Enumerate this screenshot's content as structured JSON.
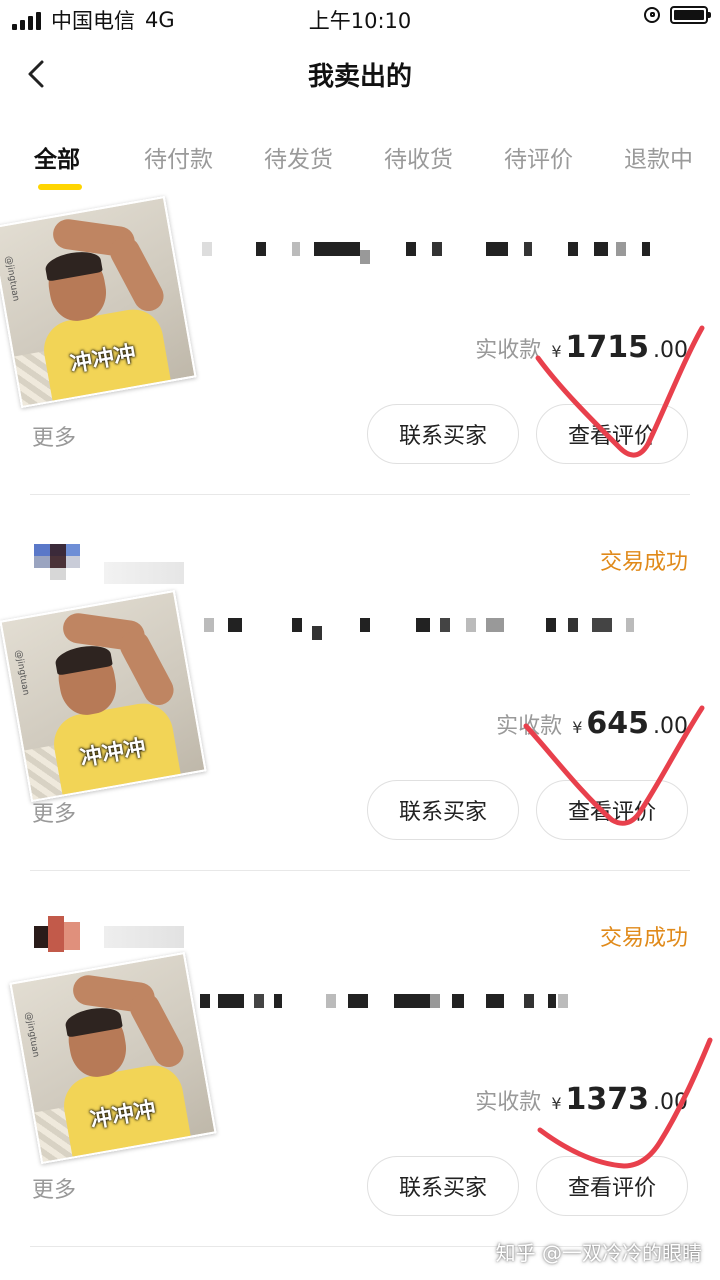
{
  "status_bar": {
    "carrier": "中国电信",
    "network": "4G",
    "time": "上午10:10"
  },
  "nav": {
    "title": "我卖出的"
  },
  "tabs": [
    {
      "label": "全部"
    },
    {
      "label": "待付款"
    },
    {
      "label": "待发货"
    },
    {
      "label": "待收货"
    },
    {
      "label": "待评价"
    },
    {
      "label": "退款中"
    }
  ],
  "orders": [
    {
      "status": "",
      "thumb_caption": "冲冲冲",
      "thumb_watermark": "@jingtuan",
      "price_label": "实收款",
      "price_currency": "¥",
      "price_int": "1715",
      "price_dec": ".00",
      "more_label": "更多",
      "contact_label": "联系买家",
      "review_label": "查看评价"
    },
    {
      "status": "交易成功",
      "thumb_caption": "冲冲冲",
      "thumb_watermark": "@jingtuan",
      "price_label": "实收款",
      "price_currency": "¥",
      "price_int": "645",
      "price_dec": ".00",
      "more_label": "更多",
      "contact_label": "联系买家",
      "review_label": "查看评价"
    },
    {
      "status": "交易成功",
      "thumb_caption": "冲冲冲",
      "thumb_watermark": "@jingtuan",
      "price_label": "实收款",
      "price_currency": "¥",
      "price_int": "1373",
      "price_dec": ".00",
      "more_label": "更多",
      "contact_label": "联系买家",
      "review_label": "查看评价"
    }
  ],
  "colors": {
    "accent": "#ffd500",
    "status": "#e08a1a",
    "annotation": "#e8404c"
  },
  "footer_watermark": "知乎 @一双冷冷的眼睛"
}
